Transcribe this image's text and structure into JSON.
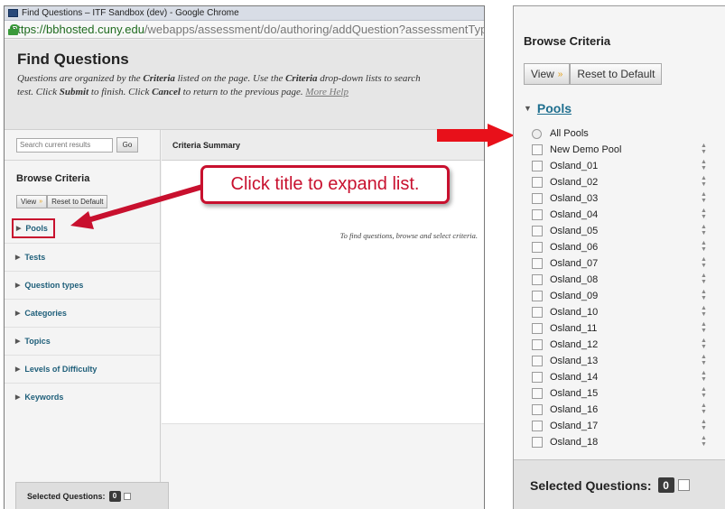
{
  "left_window": {
    "title": "Find Questions – ITF Sandbox (dev) - Google Chrome",
    "url_host": "https://bbhosted.cuny.edu",
    "url_path": "/webapps/assessment/do/authoring/addQuestion?assessmentTyp",
    "page_title": "Find Questions",
    "description_line1_a": "Questions are organized by the ",
    "description_line1_b": "Criteria",
    "description_line1_c": " listed on the page. Use the ",
    "description_line1_d": "Criteria",
    "description_line1_e": " drop-down lists to search",
    "description_line2_a": "test. Click ",
    "description_line2_b": "Submit",
    "description_line2_c": " to finish. Click ",
    "description_line2_d": "Cancel",
    "description_line2_e": " to return to the previous page. ",
    "description_more_help": "More Help",
    "search_placeholder": "Search current results",
    "go_label": "Go",
    "browse_criteria": "Browse Criteria",
    "view_label": "View",
    "reset_label": "Reset to Default",
    "criteria": [
      "Pools",
      "Tests",
      "Question types",
      "Categories",
      "Topics",
      "Levels of Difficulty",
      "Keywords"
    ],
    "criteria_summary": "Criteria Summary",
    "summary_hint": "To find questions, browse and select criteria.",
    "selected_questions_label": "Selected Questions:",
    "selected_count": "0"
  },
  "callout": {
    "text": "Click title to expand list."
  },
  "right_panel": {
    "title": "Browse Criteria",
    "view_label": "View",
    "reset_label": "Reset to Default",
    "pools_label": "Pools",
    "all_pools": "All Pools",
    "pools": [
      "New Demo Pool",
      "Osland_01",
      "Osland_02",
      "Osland_03",
      "Osland_04",
      "Osland_05",
      "Osland_06",
      "Osland_07",
      "Osland_08",
      "Osland_09",
      "Osland_10",
      "Osland_11",
      "Osland_12",
      "Osland_13",
      "Osland_14",
      "Osland_15",
      "Osland_16",
      "Osland_17",
      "Osland_18"
    ],
    "selected_questions_label": "Selected Questions:",
    "selected_count": "0"
  },
  "colors": {
    "accent_red": "#c8102e",
    "link_teal": "#1f6f8f"
  }
}
